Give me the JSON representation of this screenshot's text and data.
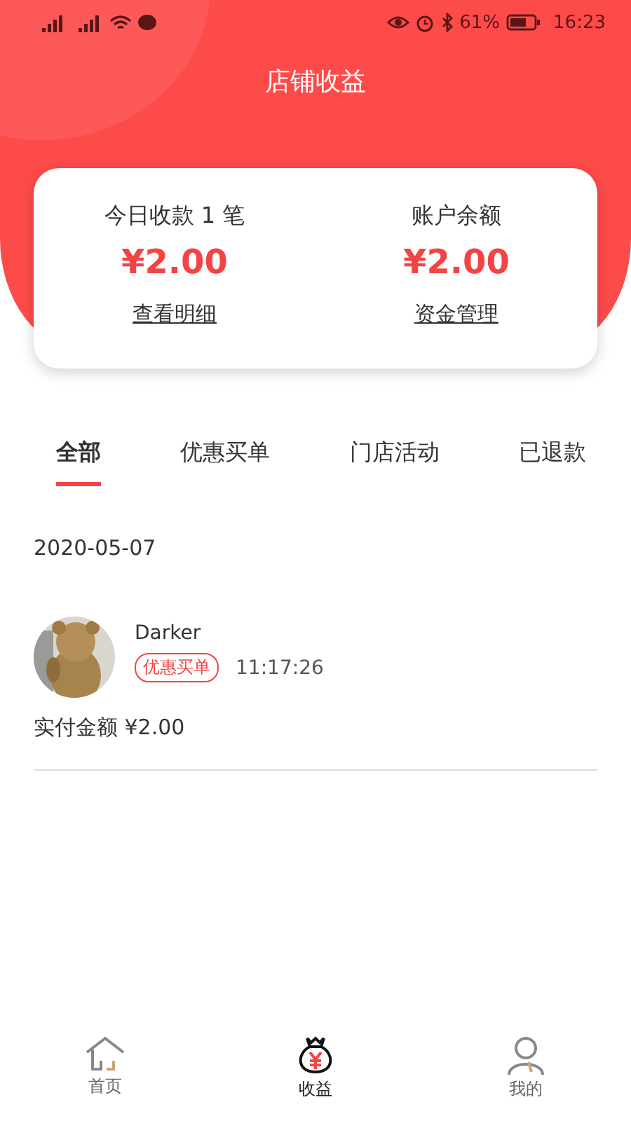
{
  "status_bar": {
    "battery": "61%",
    "time": "16:23"
  },
  "header": {
    "title": "店铺收益"
  },
  "summary": [
    {
      "label": "今日收款 1 笔",
      "amount": "¥2.00",
      "link": "查看明细"
    },
    {
      "label": "账户余额",
      "amount": "¥2.00",
      "link": "资金管理"
    }
  ],
  "tabs": [
    {
      "label": "全部",
      "selected": true
    },
    {
      "label": "优惠买单",
      "selected": false
    },
    {
      "label": "门店活动",
      "selected": false
    },
    {
      "label": "已退款",
      "selected": false
    }
  ],
  "date": "2020-05-07",
  "records": [
    {
      "name": "Darker",
      "tag": "优惠买单",
      "time": "11:17:26",
      "paid": "实付金额 ¥2.00"
    }
  ],
  "nav": [
    {
      "label": "首页",
      "selected": false
    },
    {
      "label": "收益",
      "selected": true
    },
    {
      "label": "我的",
      "selected": false
    }
  ]
}
